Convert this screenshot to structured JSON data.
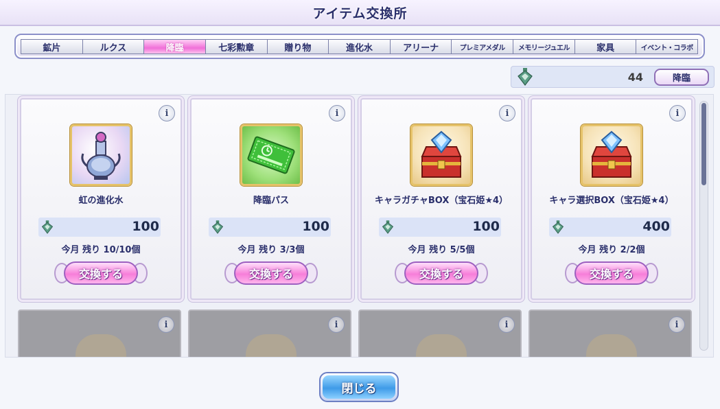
{
  "title": "アイテム交換所",
  "tabs": [
    {
      "label": "鉱片",
      "active": false,
      "small": false
    },
    {
      "label": "ルクス",
      "active": false,
      "small": false
    },
    {
      "label": "降臨",
      "active": true,
      "small": false
    },
    {
      "label": "七彩勲章",
      "active": false,
      "small": false
    },
    {
      "label": "贈り物",
      "active": false,
      "small": false
    },
    {
      "label": "進化水",
      "active": false,
      "small": false
    },
    {
      "label": "アリーナ",
      "active": false,
      "small": false
    },
    {
      "label": "プレミアメダル",
      "active": false,
      "small": true
    },
    {
      "label": "メモリージュエル",
      "active": false,
      "small": true
    },
    {
      "label": "家具",
      "active": false,
      "small": false
    },
    {
      "label": "イベント・コラボ",
      "active": false,
      "small": true
    }
  ],
  "currency": {
    "amount": "44",
    "button_label": "降臨",
    "icon": "currency-gem-icon"
  },
  "info_label": "i",
  "items": [
    {
      "name": "虹の進化水",
      "price": "100",
      "remain": "今月 残り 10/10個",
      "button": "交換する",
      "icon": "rainbow-evolution-water-icon"
    },
    {
      "name": "降臨パス",
      "price": "100",
      "remain": "今月 残り 3/3個",
      "button": "交換する",
      "icon": "advent-pass-ticket-icon"
    },
    {
      "name": "キャラガチャBOX（宝石姫★4）",
      "price": "100",
      "remain": "今月 残り 5/5個",
      "button": "交換する",
      "icon": "treasure-chest-icon"
    },
    {
      "name": "キャラ選択BOX（宝石姫★4）",
      "price": "400",
      "remain": "今月 残り 2/2個",
      "button": "交換する",
      "icon": "treasure-chest-icon"
    }
  ],
  "locked_items_count": 4,
  "close_label": "閉じる",
  "colors": {
    "accent_pink": "#f06fd8",
    "title_navy": "#2a2f6b",
    "close_blue": "#3f9be8",
    "gold_frame": "#e6c36a"
  }
}
